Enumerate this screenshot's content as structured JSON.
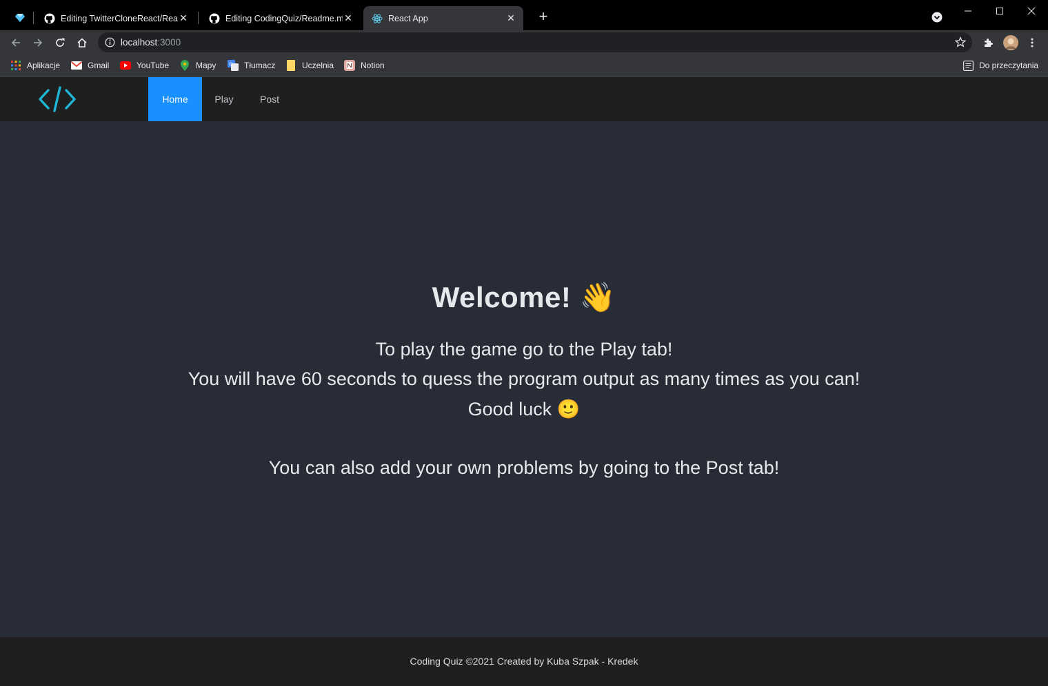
{
  "browser": {
    "tabs": [
      {
        "title": "Editing TwitterCloneReact/Readme",
        "icon": "github-icon",
        "active": false
      },
      {
        "title": "Editing CodingQuiz/Readme.md",
        "icon": "github-icon",
        "active": false
      },
      {
        "title": "React App",
        "icon": "react-icon",
        "active": true
      }
    ],
    "url": {
      "host": "localhost",
      "port": ":3000"
    },
    "bookmarks": [
      {
        "label": "Aplikacje",
        "icon": "apps-grid-icon"
      },
      {
        "label": "Gmail",
        "icon": "gmail-icon"
      },
      {
        "label": "YouTube",
        "icon": "youtube-icon"
      },
      {
        "label": "Mapy",
        "icon": "maps-pin-icon"
      },
      {
        "label": "Tłumacz",
        "icon": "translate-icon"
      },
      {
        "label": "Uczelnia",
        "icon": "folder-icon"
      },
      {
        "label": "Notion",
        "icon": "notion-icon"
      }
    ],
    "reading_list": "Do przeczytania"
  },
  "nav": {
    "items": [
      {
        "label": "Home",
        "active": true
      },
      {
        "label": "Play",
        "active": false
      },
      {
        "label": "Post",
        "active": false
      }
    ],
    "accent": "#1890ff"
  },
  "main": {
    "title": "Welcome! 👋",
    "lines": [
      "To play the game go to the Play tab!",
      "You will have 60 seconds to quess the program output as many times as you can!",
      "Good luck 🙂",
      "You can also add your own problems by going to the Post tab!"
    ]
  },
  "footer": {
    "text": "Coding Quiz ©2021 Created by Kuba Szpak - Kredek"
  }
}
